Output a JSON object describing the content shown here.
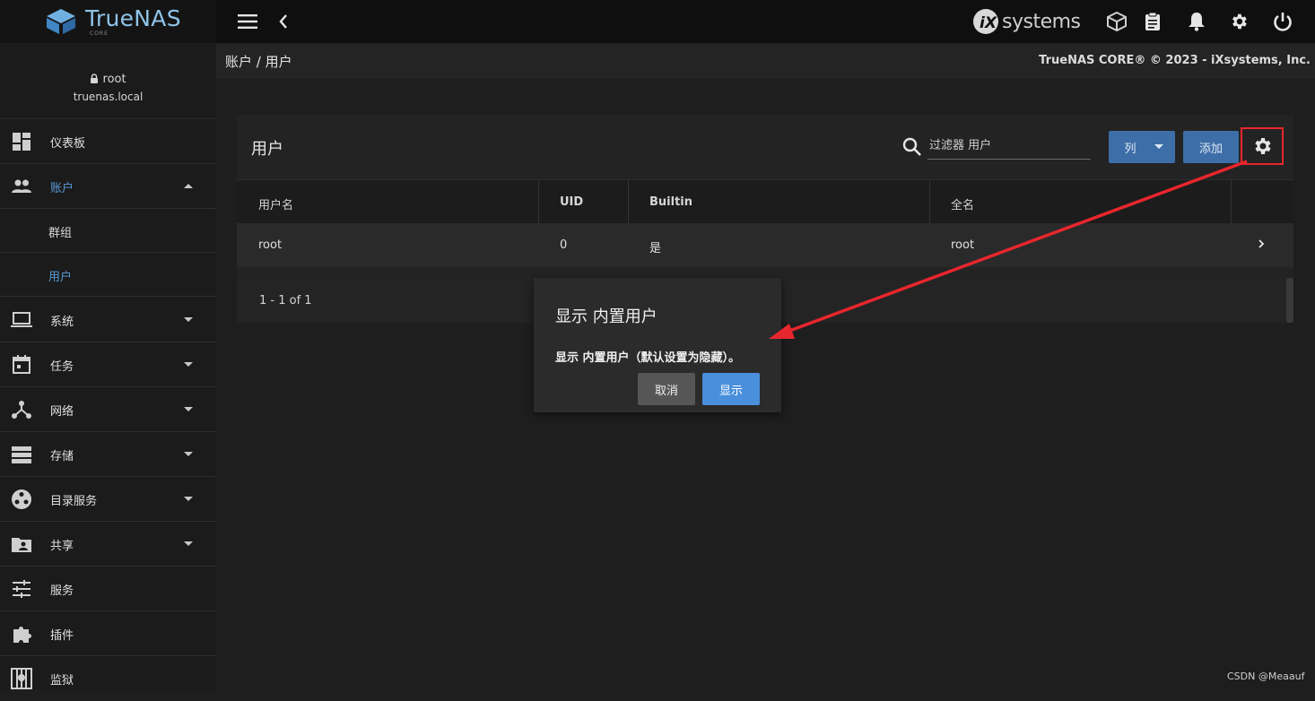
{
  "brand": {
    "name": "TrueNAS",
    "edition": "CORE",
    "vendor": "systems"
  },
  "topbar": {
    "icons": [
      "menu-icon",
      "chevron-left-icon",
      "truecommand-icon",
      "clipboard-icon",
      "bell-icon",
      "gear-icon",
      "power-icon"
    ]
  },
  "user": {
    "name": "root",
    "host": "truenas.local"
  },
  "sidebar": {
    "items": [
      {
        "label": "仪表板",
        "icon": "dashboard-icon"
      },
      {
        "label": "账户",
        "icon": "accounts-icon",
        "expanded": true
      },
      {
        "label": "系统",
        "icon": "system-icon"
      },
      {
        "label": "任务",
        "icon": "tasks-icon"
      },
      {
        "label": "网络",
        "icon": "network-icon"
      },
      {
        "label": "存储",
        "icon": "storage-icon"
      },
      {
        "label": "目录服务",
        "icon": "directory-icon"
      },
      {
        "label": "共享",
        "icon": "sharing-icon"
      },
      {
        "label": "服务",
        "icon": "services-icon"
      },
      {
        "label": "插件",
        "icon": "plugins-icon"
      },
      {
        "label": "监狱",
        "icon": "jails-icon"
      }
    ],
    "sub_items": [
      {
        "label": "群组"
      },
      {
        "label": "用户",
        "active": true
      }
    ]
  },
  "header": {
    "breadcrumb": "账户 / 用户",
    "copyright": "TrueNAS CORE® © 2023 - iXsystems, Inc."
  },
  "card": {
    "title": "用户",
    "filter_placeholder": "过滤器 用户",
    "columns_button": "列",
    "add_button": "添加"
  },
  "table": {
    "columns": [
      "用户名",
      "UID",
      "Builtin",
      "全名"
    ],
    "rows": [
      {
        "username": "root",
        "uid": "0",
        "builtin": "是",
        "fullname": "root"
      }
    ],
    "paginator": "1 - 1 of 1"
  },
  "dialog": {
    "title": "显示 内置用户",
    "message": "显示 内置用户（默认设置为隐藏）。",
    "cancel": "取消",
    "confirm": "显示"
  },
  "colors": {
    "accent": "#3d6ea8",
    "confirm": "#4a8fdc",
    "annotation": "#e8262d",
    "active_nav": "#5a9bd5"
  },
  "watermark": "CSDN @Meaauf"
}
